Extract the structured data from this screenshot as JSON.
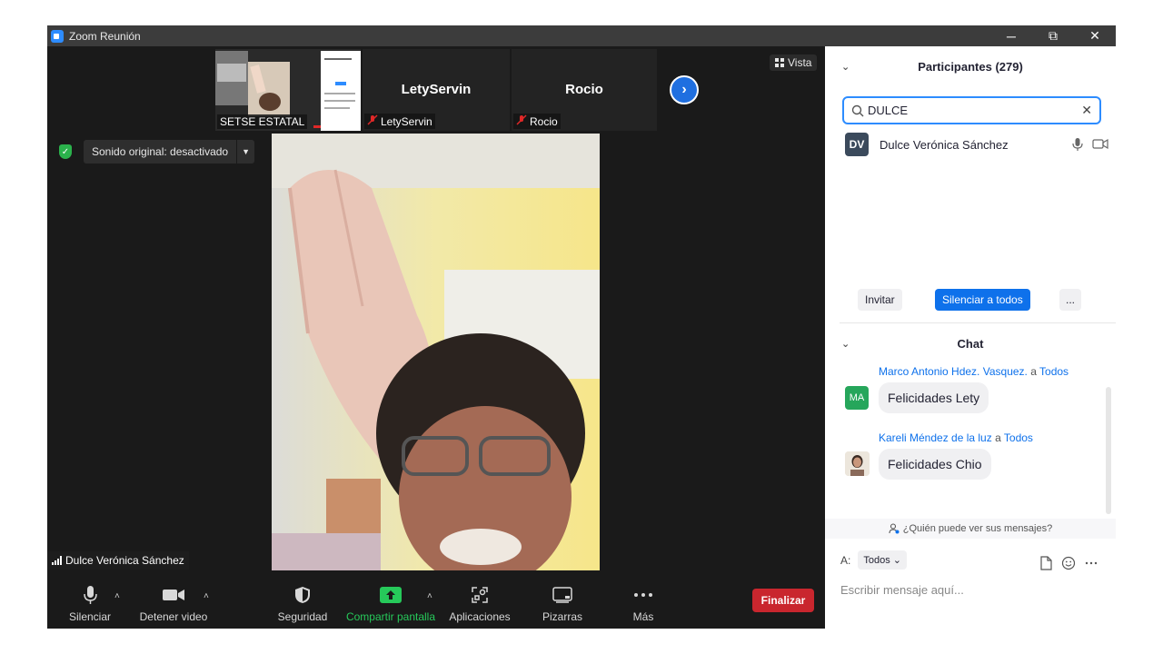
{
  "window": {
    "title": "Zoom Reunión"
  },
  "window_controls": {
    "minimize": "─",
    "restore": "⧉",
    "close": "✕"
  },
  "meeting": {
    "view_label": "Vista",
    "original_sound_label": "Sonido original: desactivado",
    "thumbnails": [
      {
        "label": "SETSE ESTATAL"
      },
      {
        "name": "LetyServin",
        "label": "LetyServin"
      },
      {
        "name": "Rocio",
        "label": "Rocio"
      }
    ],
    "active_speaker": "Dulce Verónica Sánchez"
  },
  "toolbar": {
    "mute": "Silenciar",
    "stop_video": "Detener video",
    "security": "Seguridad",
    "share_screen": "Compartir pantalla",
    "apps": "Aplicaciones",
    "whiteboards": "Pizarras",
    "more": "Más",
    "end": "Finalizar"
  },
  "participants": {
    "title": "Participantes (279)",
    "search_value": "DULCE",
    "list": [
      {
        "initials": "DV",
        "name": "Dulce Verónica Sánchez"
      }
    ],
    "invite": "Invitar",
    "mute_all": "Silenciar a todos",
    "more": "..."
  },
  "chat": {
    "title": "Chat",
    "messages": [
      {
        "initials": "MA",
        "sender": "Marco Antonio Hdez. Vasquez.",
        "to_word": "a",
        "to": "Todos",
        "text": "Felicidades Lety"
      },
      {
        "sender": "Kareli Méndez de la luz",
        "to_word": "a",
        "to": "Todos",
        "text": "Felicidades Chio"
      }
    ],
    "who_can_see": "¿Quién puede ver sus mensajes?",
    "to_label": "A:",
    "to_value": "Todos",
    "input_placeholder": "Escribir mensaje aquí..."
  },
  "colors": {
    "accent": "#2d8cff",
    "end_button": "#c9262e",
    "share_green": "#26c95a",
    "link_blue": "#0e71eb"
  }
}
